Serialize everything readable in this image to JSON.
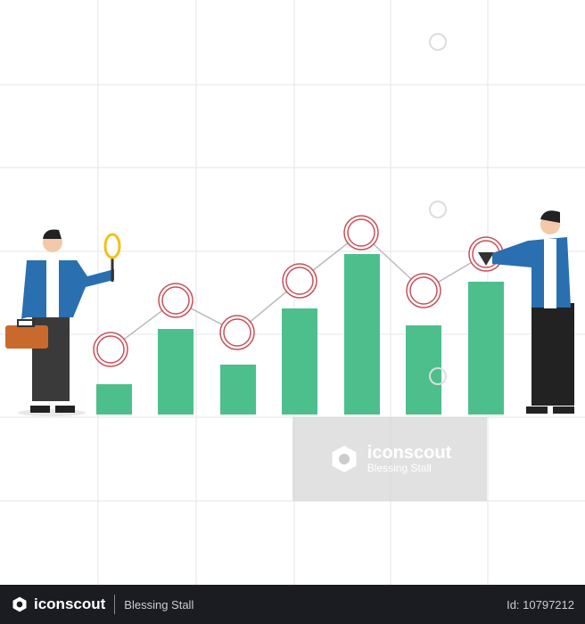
{
  "watermark": {
    "brand": "iconscout",
    "author": "Blessing Stall"
  },
  "footer": {
    "brand": "iconscout",
    "author": "Blessing Stall",
    "id_label": "Id: 10797212"
  },
  "colors": {
    "bar": "#4dbf8c",
    "marker_ring": "#c8505a",
    "jacket": "#2a6fb0",
    "footer_bg": "#1b1c22"
  }
}
